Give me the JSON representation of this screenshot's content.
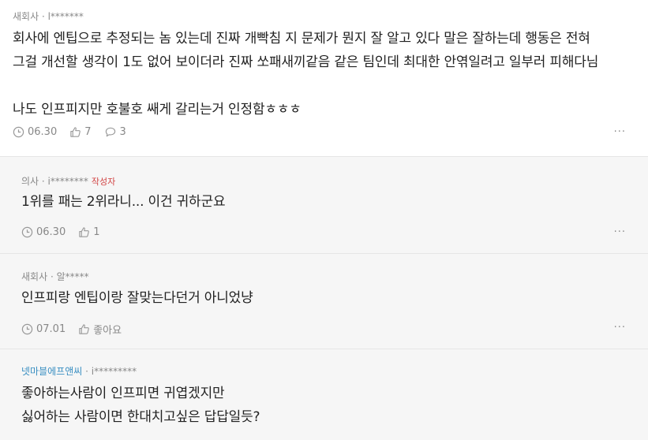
{
  "main_comment": {
    "company": "새회사",
    "author": "l*******",
    "body": "회사에 엔팁으로 추정되는 놈 있는데 진짜 개빡침 지 문제가 뭔지 잘 알고 있다 말은 잘하는데 행동은 전혀\n그걸 개선할 생각이 1도 없어 보이더라 진짜 쏘패새끼같음 같은 팀인데 최대한 안엮일려고 일부러 피해다님\n\n나도 인프피지만 호불호 쌔게 갈리는거 인정함ㅎㅎㅎ",
    "date": "06.30",
    "likes": "7",
    "replies": "3",
    "more": "···"
  },
  "replies": [
    {
      "company": "의사",
      "author": "i********",
      "badge": "작성자",
      "body": "1위를 패는 2위라니... 이건 귀하군요",
      "date": "06.30",
      "likes": "1",
      "more": "···"
    },
    {
      "company": "새회사",
      "author": "알*****",
      "body": "인프피랑 엔팁이랑 잘맞는다던거 아니었냥",
      "date": "07.01",
      "likes": "좋아요",
      "more": "···"
    },
    {
      "company": "넷마블에프앤씨",
      "author": "i*********",
      "body": "좋아하는사람이 인프피면 귀엽겠지만\n싫어하는 사람이면 한대치고싶은 답답일듯?"
    }
  ],
  "separator": " · "
}
